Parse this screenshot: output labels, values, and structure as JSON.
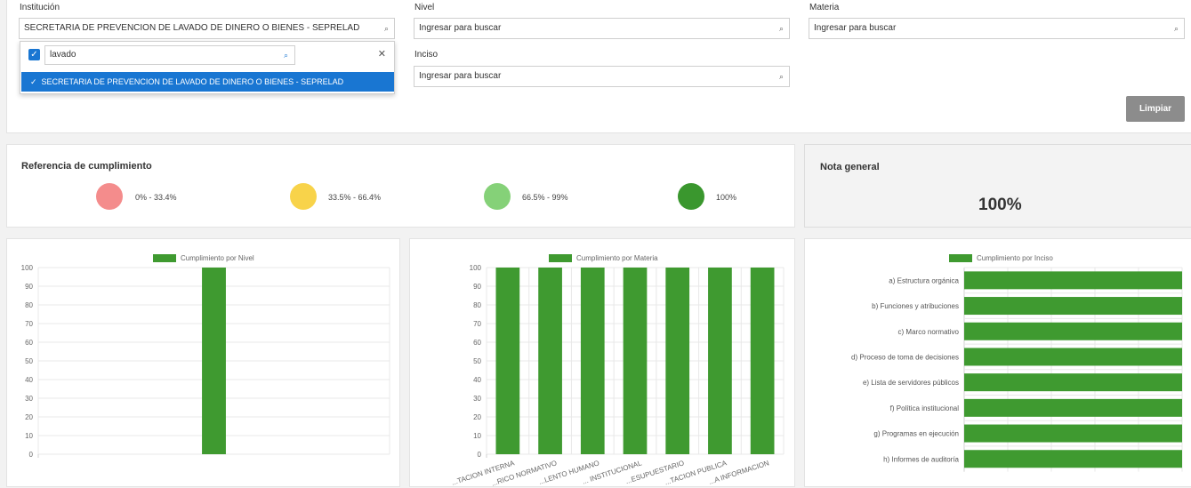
{
  "filters": {
    "institucion": {
      "label": "Institución",
      "value": "SECRETARIA DE PREVENCION DE LAVADO DE DINERO O BIENES - SEPRELAD",
      "search_text": "lavado",
      "option": "SECRETARIA DE PREVENCION DE LAVADO DE DINERO O BIENES - SEPRELAD"
    },
    "nivel": {
      "label": "Nivel",
      "placeholder": "Ingresar para buscar"
    },
    "materia": {
      "label": "Materia",
      "placeholder": "Ingresar para buscar"
    },
    "inciso": {
      "label": "Inciso",
      "placeholder": "Ingresar para buscar"
    },
    "clear_button": "Limpiar"
  },
  "reference": {
    "title": "Referencia de cumplimiento",
    "items": [
      {
        "range": "0% - 33.4%",
        "color": "#f48c8c"
      },
      {
        "range": "33.5% - 66.4%",
        "color": "#f8d34a"
      },
      {
        "range": "66.5% - 99%",
        "color": "#85d178"
      },
      {
        "range": "100%",
        "color": "#3a972e"
      }
    ]
  },
  "general": {
    "title": "Nota general",
    "value": "100%"
  },
  "chart_data": [
    {
      "type": "bar",
      "legend": "Cumplimiento por Nivel",
      "categories": [
        ""
      ],
      "values": [
        100
      ],
      "ylim": [
        0,
        100
      ],
      "yticks": [
        0,
        10,
        20,
        30,
        40,
        50,
        60,
        70,
        80,
        90,
        100
      ],
      "color": "#3f9a30",
      "grid": true,
      "legend_position": "top"
    },
    {
      "type": "bar",
      "legend": "Cumplimiento por Materia",
      "categories": [
        "...TACION INTERNA",
        "...RICO NORMATIVO",
        "...LENTO HUMANO",
        "... INSTITUCIONAL",
        "...ESUPUESTARIO",
        "...TACION PUBLICA",
        "...A INFORMACION"
      ],
      "values": [
        100,
        100,
        100,
        100,
        100,
        100,
        100
      ],
      "ylim": [
        0,
        100
      ],
      "yticks": [
        0,
        10,
        20,
        30,
        40,
        50,
        60,
        70,
        80,
        90,
        100
      ],
      "color": "#3f9a30",
      "grid": true,
      "legend_position": "top"
    },
    {
      "type": "bar",
      "orientation": "horizontal",
      "legend": "Cumplimiento por Inciso",
      "categories": [
        "a) Estructura orgánica",
        "b) Funciones y atribuciones",
        "c) Marco normativo",
        "d) Proceso de toma de decisiones",
        "e) Lista de servidores públicos",
        "f) Política institucional",
        "g) Programas en ejecución",
        "h) Informes de auditoría"
      ],
      "values": [
        100,
        100,
        100,
        100,
        100,
        100,
        100,
        100
      ],
      "xlim": [
        0,
        100
      ],
      "color": "#3f9a30",
      "grid": true,
      "legend_position": "top"
    }
  ]
}
